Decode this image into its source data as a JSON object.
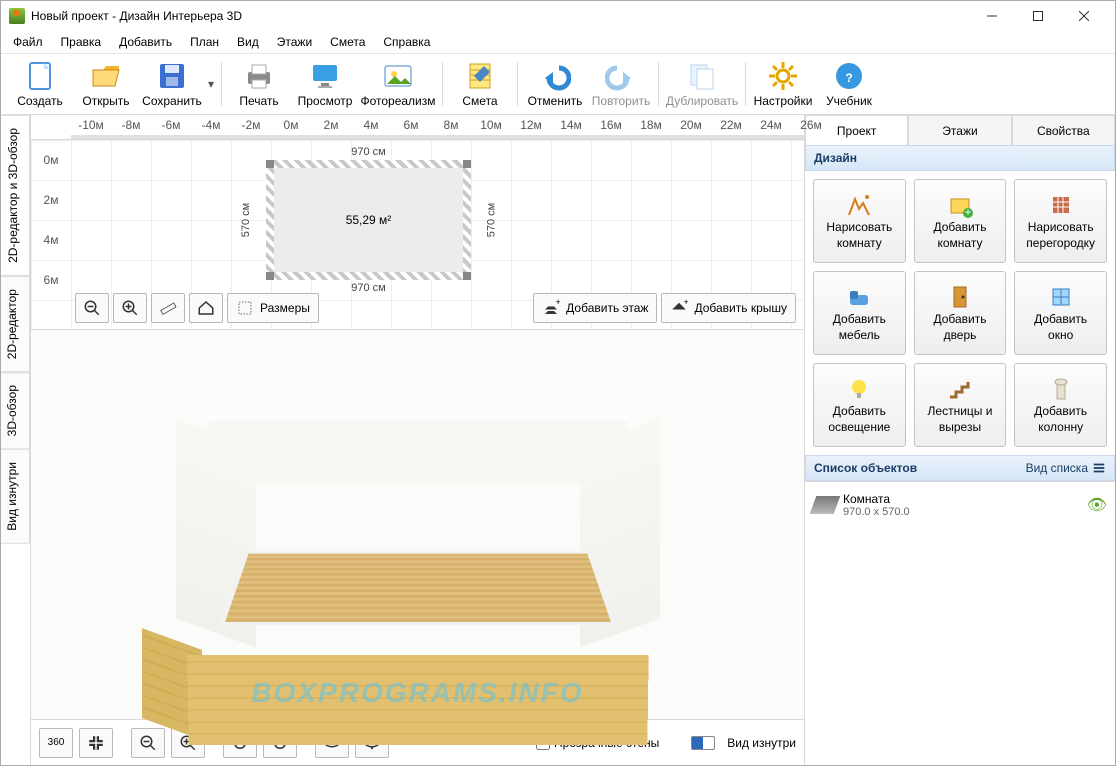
{
  "title": "Новый проект - Дизайн Интерьера 3D",
  "menu": {
    "file": "Файл",
    "edit": "Правка",
    "add": "Добавить",
    "plan": "План",
    "view": "Вид",
    "floors": "Этажи",
    "budget": "Смета",
    "help": "Справка"
  },
  "toolbar": {
    "create": "Создать",
    "open": "Открыть",
    "save": "Сохранить",
    "print": "Печать",
    "preview": "Просмотр",
    "photoreal": "Фотореализм",
    "budget": "Смета",
    "undo": "Отменить",
    "redo": "Повторить",
    "duplicate": "Дублировать",
    "settings": "Настройки",
    "tutorial": "Учебник"
  },
  "vtabs": {
    "combo": "2D-редактор и 3D-обзор",
    "editor2d": "2D-редактор",
    "view3d": "3D-обзор",
    "inside": "Вид изнутри"
  },
  "ruler": {
    "ticks": [
      "-10м",
      "-8м",
      "-6м",
      "-4м",
      "-2м",
      "0м",
      "2м",
      "4м",
      "6м",
      "8м",
      "10м",
      "12м",
      "14м",
      "16м",
      "18м",
      "20м",
      "22м",
      "24м",
      "26м"
    ],
    "vticks": [
      "0м",
      "2м",
      "4м",
      "6м"
    ]
  },
  "room": {
    "area": "55,29 м²",
    "w": "970 см",
    "h": "570 см"
  },
  "toolbar2d": {
    "sizes": "Размеры",
    "addFloor": "Добавить этаж",
    "addRoof": "Добавить крышу"
  },
  "rtabs": {
    "project": "Проект",
    "floors": "Этажи",
    "props": "Свойства"
  },
  "design": {
    "header": "Дизайн",
    "items": [
      {
        "l1": "Нарисовать",
        "l2": "комнату"
      },
      {
        "l1": "Добавить",
        "l2": "комнату"
      },
      {
        "l1": "Нарисовать",
        "l2": "перегородку"
      },
      {
        "l1": "Добавить",
        "l2": "мебель"
      },
      {
        "l1": "Добавить",
        "l2": "дверь"
      },
      {
        "l1": "Добавить",
        "l2": "окно"
      },
      {
        "l1": "Добавить",
        "l2": "освещение"
      },
      {
        "l1": "Лестницы и",
        "l2": "вырезы"
      },
      {
        "l1": "Добавить",
        "l2": "колонну"
      }
    ]
  },
  "objects": {
    "header": "Список объектов",
    "viewMode": "Вид списка",
    "item": {
      "name": "Комната",
      "dims": "970.0 x 570.0"
    }
  },
  "bottom": {
    "transparent": "Прозрачные стены",
    "inside": "Вид изнутри"
  },
  "watermark": "BOXPROGRAMS.INFO"
}
